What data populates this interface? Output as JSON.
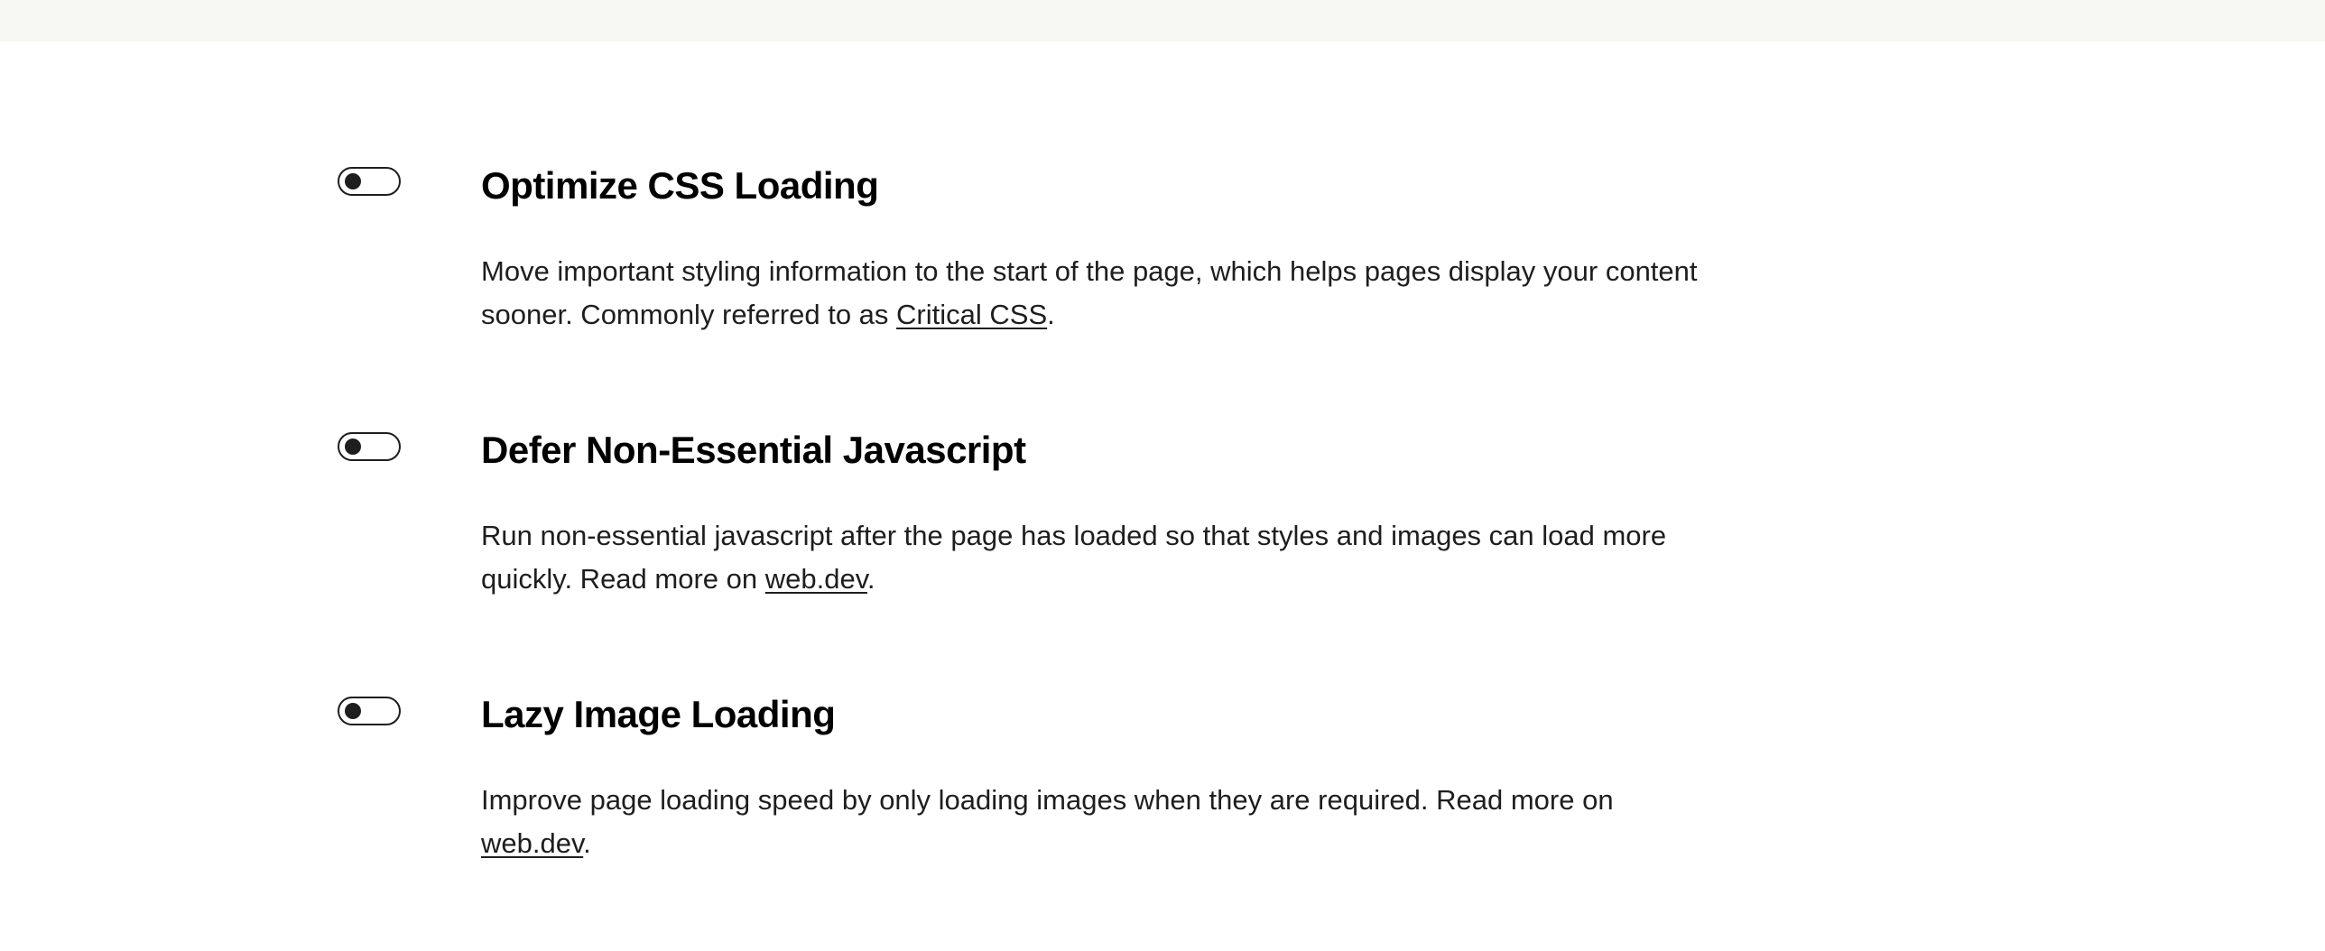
{
  "settings": [
    {
      "title": "Optimize CSS Loading",
      "enabled": false,
      "desc_before": "Move important styling information to the start of the page, which helps pages display your content sooner. Commonly referred to as ",
      "link_text": "Critical CSS",
      "desc_after": "."
    },
    {
      "title": "Defer Non-Essential Javascript",
      "enabled": false,
      "desc_before": "Run non-essential javascript after the page has loaded so that styles and images can load more quickly. Read more on ",
      "link_text": "web.dev",
      "desc_after": "."
    },
    {
      "title": "Lazy Image Loading",
      "enabled": false,
      "desc_before": "Improve page loading speed by only loading images when they are required. Read more on ",
      "link_text": "web.dev",
      "desc_after": "."
    }
  ]
}
